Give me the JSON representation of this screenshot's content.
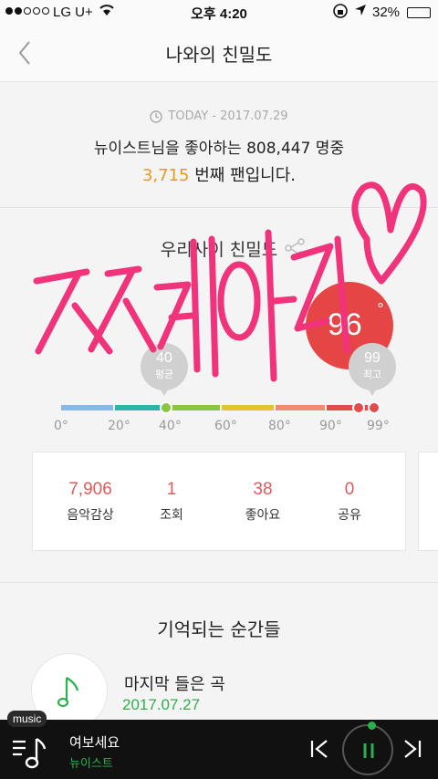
{
  "status": {
    "carrier": "LG U+",
    "time": "오후 4:20",
    "battery": "32%",
    "battery_level": 0.32,
    "signal_bars": 2
  },
  "nav": {
    "title": "나와의 친밀도",
    "back_icon": "chevron-left-icon"
  },
  "today": {
    "date": "TODAY - 2017.07.29",
    "line1": "뉴이스트님을 좋아하는 808,447 명중",
    "rank": "3,715",
    "rank_suffix": " 번째 팬입니다.",
    "accent_color": "#e8962c"
  },
  "intimacy": {
    "title": "우리사이 친밀도",
    "share_icon": "share-icon",
    "score": "96",
    "score_degree": "°",
    "average": {
      "value": "40",
      "label": "평균"
    },
    "max": {
      "value": "99",
      "label": "최고"
    },
    "scale": {
      "min": 0,
      "max": 99,
      "user": 96,
      "average": 40
    },
    "ticks": [
      "0°",
      "20°",
      "40°",
      "60°",
      "80°",
      "90°",
      "99°"
    ],
    "segments": [
      {
        "from": 0,
        "to": 20,
        "color": "#86b8e8"
      },
      {
        "from": 20,
        "to": 40,
        "color": "#2bb5a6"
      },
      {
        "from": 40,
        "to": 60,
        "color": "#8cc63f"
      },
      {
        "from": 60,
        "to": 80,
        "color": "#e2c42c"
      },
      {
        "from": 80,
        "to": 90,
        "color": "#ee8c6b"
      },
      {
        "from": 90,
        "to": 99,
        "color": "#e14b4b"
      }
    ]
  },
  "stats": [
    {
      "value": "7,906",
      "label": "음악감상"
    },
    {
      "value": "1",
      "label": "조회"
    },
    {
      "value": "38",
      "label": "좋아요"
    },
    {
      "value": "0",
      "label": "공유"
    }
  ],
  "moments": {
    "title": "기억되는 순간들",
    "item_label": "마지막 들은 곡",
    "item_date": "2017.07.27",
    "icon": "music-note-icon"
  },
  "player": {
    "tag": "music",
    "song": "여보세요",
    "artist": "뉴이스트",
    "accent_color": "#2ab14e"
  }
}
